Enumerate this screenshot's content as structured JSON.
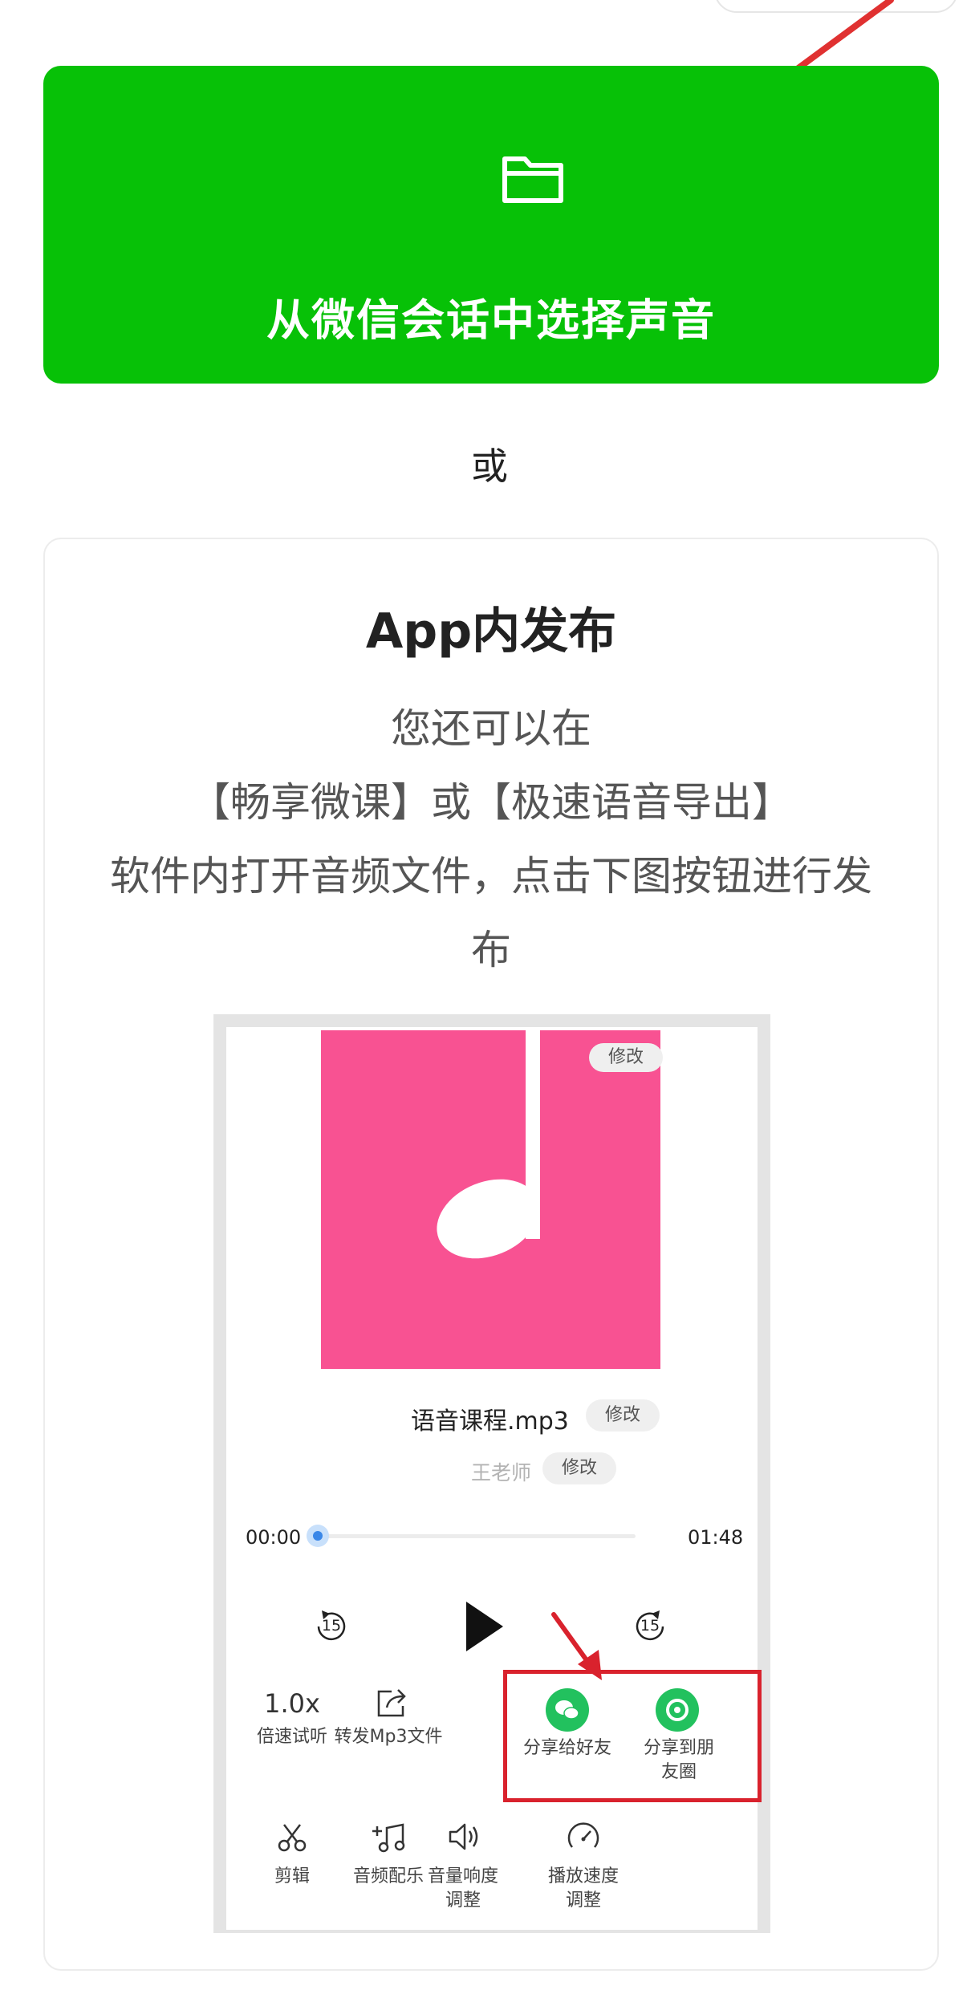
{
  "primary_action": {
    "label": "从微信会话中选择声音",
    "icon": "folder-icon",
    "color": "#07c107"
  },
  "separator": "或",
  "app_publish": {
    "title": "App内发布",
    "description_lines": [
      "您还可以在",
      "【畅享微课】或【极速语音导出】",
      "软件内打开音频文件，点击下图按钮进行发",
      "布"
    ]
  },
  "illustration": {
    "cover_edit_label": "修改",
    "cover_color": "#f85292",
    "file_name": "语音课程.mp3",
    "file_edit_label": "修改",
    "author": "王老师",
    "author_edit_label": "修改",
    "time_current": "00:00",
    "time_total": "01:48",
    "progress": 0,
    "rewind_label": "15",
    "forward_label": "15",
    "actions_row1": [
      {
        "icon_text": "1.0x",
        "label": "倍速试听"
      },
      {
        "icon": "forward-share-icon",
        "label": "转发Mp3文件"
      },
      {
        "icon": "wechat-icon",
        "label": "分享给好友"
      },
      {
        "icon": "moments-icon",
        "label_lines": [
          "分享到朋",
          "友圈"
        ]
      }
    ],
    "actions_row2": [
      {
        "icon": "scissors-icon",
        "label": "剪辑"
      },
      {
        "icon": "music-note-icon",
        "label": "音频配乐"
      },
      {
        "icon": "volume-icon",
        "label_lines": [
          "音量响度",
          "调整"
        ]
      },
      {
        "icon": "speed-gauge-icon",
        "label_lines": [
          "播放速度",
          "调整"
        ]
      }
    ],
    "highlight_color": "#d9222d"
  }
}
